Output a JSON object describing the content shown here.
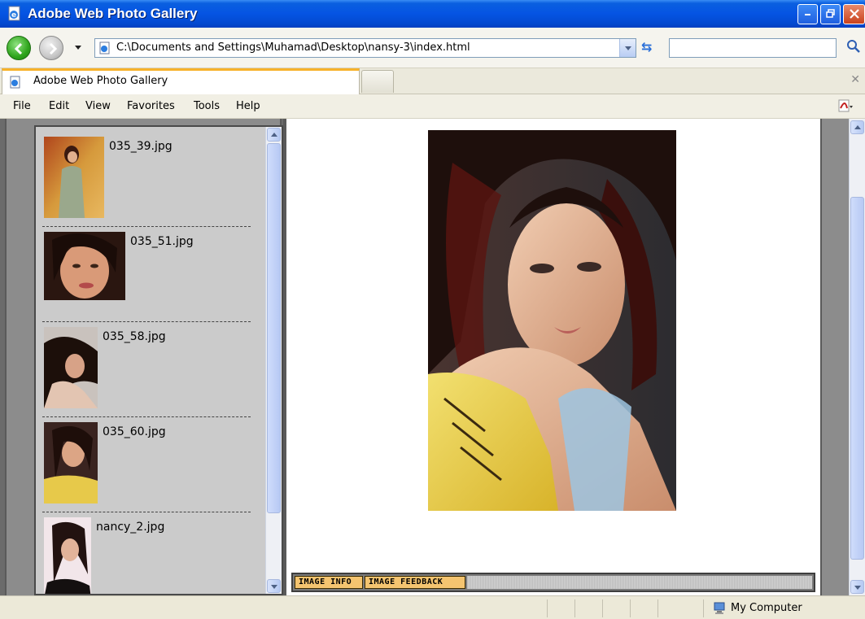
{
  "window": {
    "title": "Adobe Web Photo Gallery",
    "controls": [
      "minimize",
      "restore",
      "close"
    ]
  },
  "address_bar": {
    "url": "C:\\Documents and Settings\\Muhamad\\Desktop\\nansy-3\\index.html",
    "search_value": ""
  },
  "tabs": [
    {
      "label": "Adobe Web Photo Gallery",
      "active": true
    }
  ],
  "menu": [
    "File",
    "Edit",
    "View",
    "Favorites",
    "Tools",
    "Help"
  ],
  "gallery": {
    "thumbnails": [
      {
        "caption": "035_39.jpg"
      },
      {
        "caption": "035_51.jpg"
      },
      {
        "caption": "035_58.jpg"
      },
      {
        "caption": "035_60.jpg"
      },
      {
        "caption": "nancy_2.jpg"
      }
    ],
    "info_tabs": [
      "IMAGE INFO",
      "IMAGE FEEDBACK"
    ]
  },
  "status": {
    "zone": "My Computer"
  },
  "colors": {
    "titlebar": "#0554e3",
    "tab_accent": "#f7b22a",
    "info_tab_bg": "#f4c470",
    "panel_bg": "#cbcbcb"
  }
}
